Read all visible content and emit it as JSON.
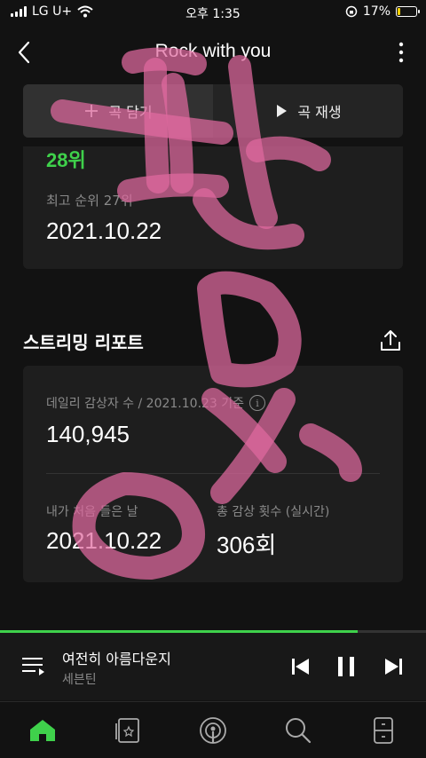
{
  "status": {
    "carrier": "LG U+",
    "time": "오후 1:35",
    "battery_percent": 17,
    "battery_text": "17%",
    "accent": "#f5d000"
  },
  "header": {
    "title": "Rock with you",
    "back_icon": "chevron-left-icon",
    "more_icon": "more-vertical-icon"
  },
  "actions": {
    "add_label": "곡 담기",
    "play_label": "곡 재생"
  },
  "rank": {
    "current": "28위",
    "peak_label": "최고 순위 27위",
    "peak_date": "2021.10.22",
    "color": "#3fd14b"
  },
  "report": {
    "title": "스트리밍 리포트",
    "daily_label": "데일리 감상자 수 / 2021.10.23 기준",
    "daily_value": "140,945",
    "first_listen_label": "내가 처음 들은 날",
    "first_listen_value": "2021.10.22",
    "total_plays_label": "총 감상 횟수 (실시간)",
    "total_plays_value": "306회"
  },
  "player": {
    "track": "여전히 아름다운지",
    "artist": "세븐틴",
    "progress": 0.84
  },
  "nav": {
    "items": [
      "home-icon",
      "library-icon",
      "podcast-icon",
      "search-icon",
      "storage-icon"
    ],
    "active_color": "#3fd14b"
  },
  "watermark": {
    "text": "판매",
    "color": "#e06aa0"
  }
}
